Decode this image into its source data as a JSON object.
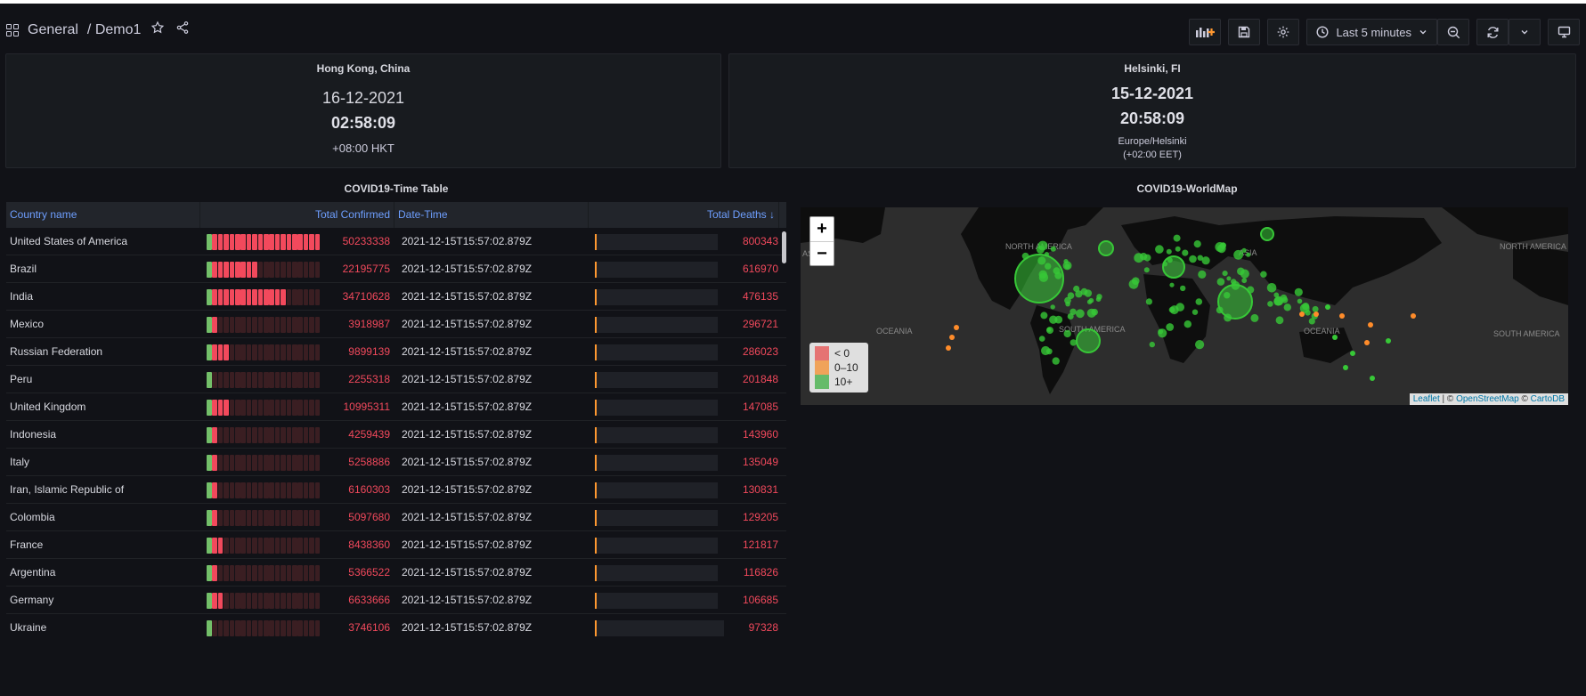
{
  "header": {
    "folder": "General",
    "separator": "/",
    "dashboard": "Demo1",
    "time_range": "Last 5 minutes"
  },
  "clock_hk": {
    "title": "Hong Kong, China",
    "date": "16-12-2021",
    "time": "02:58:09",
    "zone": "+08:00 HKT"
  },
  "clock_hel": {
    "title": "Helsinki, FI",
    "date": "15-12-2021",
    "time": "20:58:09",
    "zone": "Europe/Helsinki",
    "offset": "(+02:00 EET)"
  },
  "table": {
    "title": "COVID19-Time Table",
    "headers": {
      "country": "Country name",
      "confirmed": "Total Confirmed",
      "datetime": "Date-Time",
      "deaths": "Total Deaths",
      "sort_icon": "arrow-down-icon"
    },
    "rows": [
      {
        "country": "United States of America",
        "confirmed": "50233338",
        "datetime": "2021-12-15T15:57:02.879Z",
        "deaths": "800343",
        "confirmed_fraction": 1.0,
        "deaths_fraction": 0.02
      },
      {
        "country": "Brazil",
        "confirmed": "22195775",
        "datetime": "2021-12-15T15:57:02.879Z",
        "deaths": "616970",
        "confirmed_fraction": 0.44,
        "deaths_fraction": 0.015
      },
      {
        "country": "India",
        "confirmed": "34710628",
        "datetime": "2021-12-15T15:57:02.879Z",
        "deaths": "476135",
        "confirmed_fraction": 0.69,
        "deaths_fraction": 0.012
      },
      {
        "country": "Mexico",
        "confirmed": "3918987",
        "datetime": "2021-12-15T15:57:02.879Z",
        "deaths": "296721",
        "confirmed_fraction": 0.08,
        "deaths_fraction": 0.008
      },
      {
        "country": "Russian Federation",
        "confirmed": "9899139",
        "datetime": "2021-12-15T15:57:02.879Z",
        "deaths": "286023",
        "confirmed_fraction": 0.2,
        "deaths_fraction": 0.008
      },
      {
        "country": "Peru",
        "confirmed": "2255318",
        "datetime": "2021-12-15T15:57:02.879Z",
        "deaths": "201848",
        "confirmed_fraction": 0.04,
        "deaths_fraction": 0.006
      },
      {
        "country": "United Kingdom",
        "confirmed": "10995311",
        "datetime": "2021-12-15T15:57:02.879Z",
        "deaths": "147085",
        "confirmed_fraction": 0.22,
        "deaths_fraction": 0.005
      },
      {
        "country": "Indonesia",
        "confirmed": "4259439",
        "datetime": "2021-12-15T15:57:02.879Z",
        "deaths": "143960",
        "confirmed_fraction": 0.09,
        "deaths_fraction": 0.005
      },
      {
        "country": "Italy",
        "confirmed": "5258886",
        "datetime": "2021-12-15T15:57:02.879Z",
        "deaths": "135049",
        "confirmed_fraction": 0.1,
        "deaths_fraction": 0.005
      },
      {
        "country": "Iran, Islamic Republic of",
        "confirmed": "6160303",
        "datetime": "2021-12-15T15:57:02.879Z",
        "deaths": "130831",
        "confirmed_fraction": 0.12,
        "deaths_fraction": 0.005
      },
      {
        "country": "Colombia",
        "confirmed": "5097680",
        "datetime": "2021-12-15T15:57:02.879Z",
        "deaths": "129205",
        "confirmed_fraction": 0.1,
        "deaths_fraction": 0.005
      },
      {
        "country": "France",
        "confirmed": "8438360",
        "datetime": "2021-12-15T15:57:02.879Z",
        "deaths": "121817",
        "confirmed_fraction": 0.17,
        "deaths_fraction": 0.004
      },
      {
        "country": "Argentina",
        "confirmed": "5366522",
        "datetime": "2021-12-15T15:57:02.879Z",
        "deaths": "116826",
        "confirmed_fraction": 0.11,
        "deaths_fraction": 0.004
      },
      {
        "country": "Germany",
        "confirmed": "6633666",
        "datetime": "2021-12-15T15:57:02.879Z",
        "deaths": "106685",
        "confirmed_fraction": 0.13,
        "deaths_fraction": 0.004
      },
      {
        "country": "Ukraine",
        "confirmed": "3746106",
        "datetime": "2021-12-15T15:57:02.879Z",
        "deaths": "97328",
        "confirmed_fraction": 0.07,
        "deaths_fraction": 0.004
      }
    ]
  },
  "map": {
    "title": "COVID19-WorldMap",
    "zoom_in": "+",
    "zoom_out": "−",
    "labels": [
      "ASIA",
      "NORTH AMERICA",
      "ASIA",
      "NORTH AMERICA",
      "OCEANIA",
      "SOUTH AMERICA",
      "OCEANIA",
      "SOUTH AMERICA"
    ],
    "legend": [
      {
        "label": "< 0",
        "color": "#e57373"
      },
      {
        "label": "0–10",
        "color": "#f0a35a"
      },
      {
        "label": "10+",
        "color": "#66bb6a"
      }
    ],
    "attribution": {
      "leaflet": "Leaflet",
      "sep1": " | © ",
      "osm": "OpenStreetMap",
      "sep2": " © ",
      "carto": "CartoDB"
    }
  },
  "colors": {
    "background": "#111217",
    "panel": "#181b1f",
    "header_link": "#6e9fff",
    "value_red": "#f2495c",
    "gauge_green": "#73bf69",
    "gauge_red": "#f2495c",
    "death_marker": "#ff9830",
    "map_green": "#37c837",
    "map_orange": "#ff8c2a"
  },
  "icons": {
    "apps": "apps-grid-icon",
    "star": "star-icon",
    "share": "share-icon",
    "add_panel": "add-panel-icon",
    "save": "save-icon",
    "settings": "gear-icon",
    "clock": "clock-icon",
    "chevron": "chevron-down-icon",
    "zoom_out": "zoom-out-icon",
    "refresh": "refresh-icon",
    "tv": "tv-mode-icon"
  }
}
